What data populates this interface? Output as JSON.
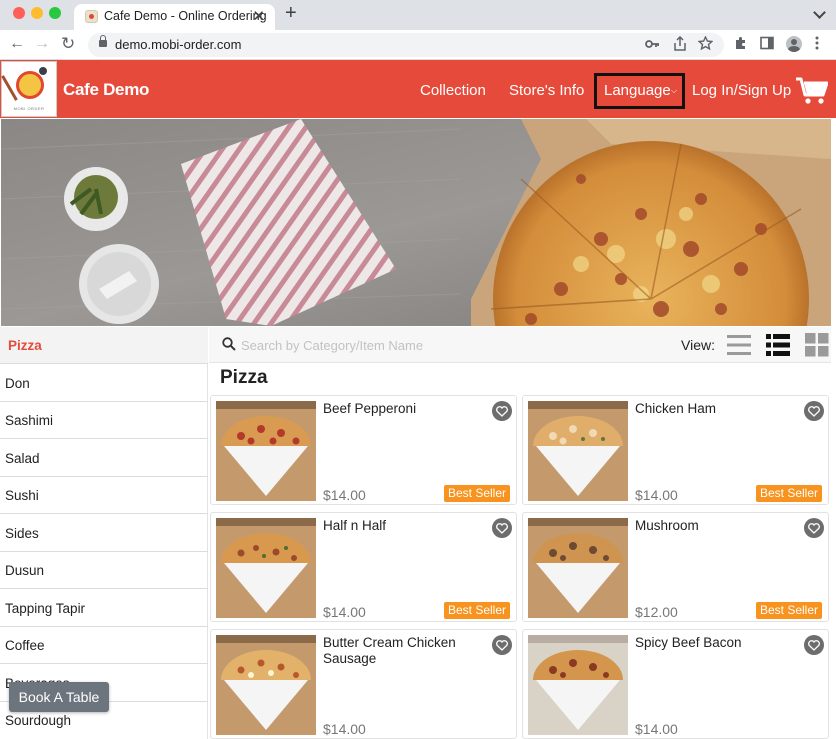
{
  "browser": {
    "tab_title": "Cafe Demo - Online Ordering",
    "tab_close": "✕",
    "new_tab": "+",
    "url": "demo.mobi-order.com",
    "back": "←",
    "forward": "→",
    "reload": "↻"
  },
  "header": {
    "brand": "Cafe Demo",
    "logo_caption": "MOBI ORDER",
    "nav": {
      "collection": "Collection",
      "store_info": "Store's Info",
      "language": "Language",
      "login": "Log In/Sign Up"
    },
    "accent_color": "#e64a3b"
  },
  "search": {
    "placeholder": "Search by Category/Item Name",
    "value": ""
  },
  "view": {
    "label": "View:",
    "modes": [
      "list-view-icon",
      "detailed-list-view-icon",
      "grid-view-icon"
    ],
    "selected": "detailed-list-view-icon"
  },
  "sidebar": {
    "items": [
      {
        "label": "Pizza",
        "active": true
      },
      {
        "label": "Don",
        "active": false
      },
      {
        "label": "Sashimi",
        "active": false
      },
      {
        "label": "Salad",
        "active": false
      },
      {
        "label": "Sushi",
        "active": false
      },
      {
        "label": "Sides",
        "active": false
      },
      {
        "label": "Dusun",
        "active": false
      },
      {
        "label": "Tapping Tapir",
        "active": false
      },
      {
        "label": "Coffee",
        "active": false
      },
      {
        "label": "Beverages",
        "active": false
      },
      {
        "label": "Sourdough",
        "active": false
      }
    ]
  },
  "book_table": "Book A Table",
  "section": {
    "title": "Pizza"
  },
  "products": [
    {
      "name": "Beef Pepperoni",
      "price": "$14.00",
      "badge": "Best Seller"
    },
    {
      "name": "Chicken Ham",
      "price": "$14.00",
      "badge": "Best Seller"
    },
    {
      "name": "Half n Half",
      "price": "$14.00",
      "badge": "Best Seller"
    },
    {
      "name": "Mushroom",
      "price": "$12.00",
      "badge": "Best Seller"
    },
    {
      "name": "Butter Cream Chicken Sausage",
      "price": "$14.00",
      "badge": ""
    },
    {
      "name": "Spicy Beef Bacon",
      "price": "$14.00",
      "badge": ""
    }
  ]
}
